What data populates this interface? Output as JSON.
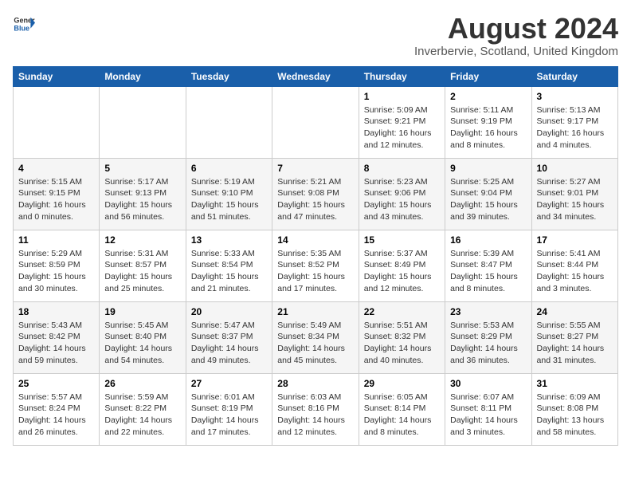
{
  "header": {
    "logo_general": "General",
    "logo_blue": "Blue",
    "month_year": "August 2024",
    "location": "Inverbervie, Scotland, United Kingdom"
  },
  "days_of_week": [
    "Sunday",
    "Monday",
    "Tuesday",
    "Wednesday",
    "Thursday",
    "Friday",
    "Saturday"
  ],
  "weeks": [
    [
      {
        "day": "",
        "info": ""
      },
      {
        "day": "",
        "info": ""
      },
      {
        "day": "",
        "info": ""
      },
      {
        "day": "",
        "info": ""
      },
      {
        "day": "1",
        "info": "Sunrise: 5:09 AM\nSunset: 9:21 PM\nDaylight: 16 hours\nand 12 minutes."
      },
      {
        "day": "2",
        "info": "Sunrise: 5:11 AM\nSunset: 9:19 PM\nDaylight: 16 hours\nand 8 minutes."
      },
      {
        "day": "3",
        "info": "Sunrise: 5:13 AM\nSunset: 9:17 PM\nDaylight: 16 hours\nand 4 minutes."
      }
    ],
    [
      {
        "day": "4",
        "info": "Sunrise: 5:15 AM\nSunset: 9:15 PM\nDaylight: 16 hours\nand 0 minutes."
      },
      {
        "day": "5",
        "info": "Sunrise: 5:17 AM\nSunset: 9:13 PM\nDaylight: 15 hours\nand 56 minutes."
      },
      {
        "day": "6",
        "info": "Sunrise: 5:19 AM\nSunset: 9:10 PM\nDaylight: 15 hours\nand 51 minutes."
      },
      {
        "day": "7",
        "info": "Sunrise: 5:21 AM\nSunset: 9:08 PM\nDaylight: 15 hours\nand 47 minutes."
      },
      {
        "day": "8",
        "info": "Sunrise: 5:23 AM\nSunset: 9:06 PM\nDaylight: 15 hours\nand 43 minutes."
      },
      {
        "day": "9",
        "info": "Sunrise: 5:25 AM\nSunset: 9:04 PM\nDaylight: 15 hours\nand 39 minutes."
      },
      {
        "day": "10",
        "info": "Sunrise: 5:27 AM\nSunset: 9:01 PM\nDaylight: 15 hours\nand 34 minutes."
      }
    ],
    [
      {
        "day": "11",
        "info": "Sunrise: 5:29 AM\nSunset: 8:59 PM\nDaylight: 15 hours\nand 30 minutes."
      },
      {
        "day": "12",
        "info": "Sunrise: 5:31 AM\nSunset: 8:57 PM\nDaylight: 15 hours\nand 25 minutes."
      },
      {
        "day": "13",
        "info": "Sunrise: 5:33 AM\nSunset: 8:54 PM\nDaylight: 15 hours\nand 21 minutes."
      },
      {
        "day": "14",
        "info": "Sunrise: 5:35 AM\nSunset: 8:52 PM\nDaylight: 15 hours\nand 17 minutes."
      },
      {
        "day": "15",
        "info": "Sunrise: 5:37 AM\nSunset: 8:49 PM\nDaylight: 15 hours\nand 12 minutes."
      },
      {
        "day": "16",
        "info": "Sunrise: 5:39 AM\nSunset: 8:47 PM\nDaylight: 15 hours\nand 8 minutes."
      },
      {
        "day": "17",
        "info": "Sunrise: 5:41 AM\nSunset: 8:44 PM\nDaylight: 15 hours\nand 3 minutes."
      }
    ],
    [
      {
        "day": "18",
        "info": "Sunrise: 5:43 AM\nSunset: 8:42 PM\nDaylight: 14 hours\nand 59 minutes."
      },
      {
        "day": "19",
        "info": "Sunrise: 5:45 AM\nSunset: 8:40 PM\nDaylight: 14 hours\nand 54 minutes."
      },
      {
        "day": "20",
        "info": "Sunrise: 5:47 AM\nSunset: 8:37 PM\nDaylight: 14 hours\nand 49 minutes."
      },
      {
        "day": "21",
        "info": "Sunrise: 5:49 AM\nSunset: 8:34 PM\nDaylight: 14 hours\nand 45 minutes."
      },
      {
        "day": "22",
        "info": "Sunrise: 5:51 AM\nSunset: 8:32 PM\nDaylight: 14 hours\nand 40 minutes."
      },
      {
        "day": "23",
        "info": "Sunrise: 5:53 AM\nSunset: 8:29 PM\nDaylight: 14 hours\nand 36 minutes."
      },
      {
        "day": "24",
        "info": "Sunrise: 5:55 AM\nSunset: 8:27 PM\nDaylight: 14 hours\nand 31 minutes."
      }
    ],
    [
      {
        "day": "25",
        "info": "Sunrise: 5:57 AM\nSunset: 8:24 PM\nDaylight: 14 hours\nand 26 minutes."
      },
      {
        "day": "26",
        "info": "Sunrise: 5:59 AM\nSunset: 8:22 PM\nDaylight: 14 hours\nand 22 minutes."
      },
      {
        "day": "27",
        "info": "Sunrise: 6:01 AM\nSunset: 8:19 PM\nDaylight: 14 hours\nand 17 minutes."
      },
      {
        "day": "28",
        "info": "Sunrise: 6:03 AM\nSunset: 8:16 PM\nDaylight: 14 hours\nand 12 minutes."
      },
      {
        "day": "29",
        "info": "Sunrise: 6:05 AM\nSunset: 8:14 PM\nDaylight: 14 hours\nand 8 minutes."
      },
      {
        "day": "30",
        "info": "Sunrise: 6:07 AM\nSunset: 8:11 PM\nDaylight: 14 hours\nand 3 minutes."
      },
      {
        "day": "31",
        "info": "Sunrise: 6:09 AM\nSunset: 8:08 PM\nDaylight: 13 hours\nand 58 minutes."
      }
    ]
  ]
}
